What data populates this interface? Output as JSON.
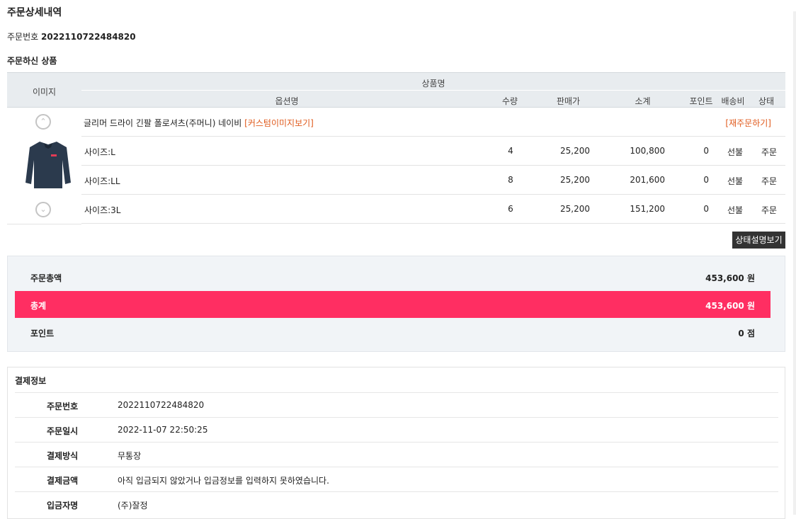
{
  "page": {
    "title": "주문상세내역",
    "order_label": "주문번호",
    "order_number": "2022110722484820",
    "section_title": "주문하신 상품"
  },
  "table": {
    "headers": {
      "image": "이미지",
      "product_name": "상품명",
      "option": "옵션명",
      "qty": "수량",
      "price": "판매가",
      "subtotal": "소계",
      "point": "포인트",
      "shipping": "배송비",
      "status": "상태"
    },
    "product": {
      "name": "글리머 드라이 긴팔 폴로셔츠(주머니) 네이비",
      "custom_link": "[커스텀이미지보기]",
      "reorder_link": "[재주문하기]"
    },
    "rows": [
      {
        "option": "사이즈:L",
        "qty": "4",
        "price": "25,200",
        "subtotal": "100,800",
        "point": "0",
        "shipping": "선불",
        "status": "주문"
      },
      {
        "option": "사이즈:LL",
        "qty": "8",
        "price": "25,200",
        "subtotal": "201,600",
        "point": "0",
        "shipping": "선불",
        "status": "주문"
      },
      {
        "option": "사이즈:3L",
        "qty": "6",
        "price": "25,200",
        "subtotal": "151,200",
        "point": "0",
        "shipping": "선불",
        "status": "주문"
      }
    ],
    "status_button": "상태설명보기"
  },
  "totals": {
    "order_total_label": "주문총액",
    "order_total_value": "453,600 원",
    "total_label": "총계",
    "total_value": "453,600 원",
    "point_label": "포인트",
    "point_value": "0 점",
    "highlight_color": "#ff2e62"
  },
  "payment": {
    "title": "결제정보",
    "rows": [
      {
        "label": "주문번호",
        "value": "2022110722484820"
      },
      {
        "label": "주문일시",
        "value": "2022-11-07 22:50:25"
      },
      {
        "label": "결제방식",
        "value": "무통장"
      },
      {
        "label": "결제금액",
        "value": "아직 입금되지 않았거나 입금정보를 입력하지 못하였습니다."
      },
      {
        "label": "입금자명",
        "value": "(주)잘정"
      }
    ]
  }
}
